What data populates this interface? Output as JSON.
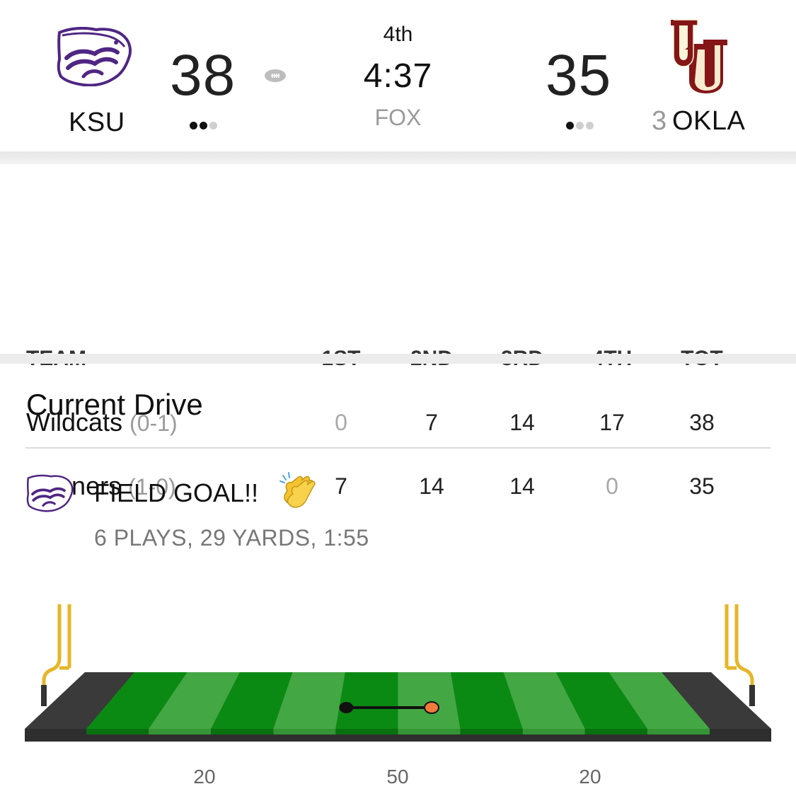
{
  "game": {
    "period": "4th",
    "clock": "4:37",
    "network": "FOX"
  },
  "away": {
    "abbr": "KSU",
    "score": "38",
    "timeouts_used": 2,
    "timeouts_total": 3,
    "color": "#4f2683"
  },
  "home": {
    "rank": "3",
    "abbr": "OKLA",
    "score": "35",
    "timeouts_used": 1,
    "timeouts_total": 3,
    "color": "#841617"
  },
  "possession": "away",
  "linescore": {
    "headers": [
      "TEAM",
      "1ST",
      "2ND",
      "3RD",
      "4TH",
      "TOT"
    ],
    "rows": [
      {
        "name": "Wildcats",
        "record": "(0-1)",
        "q": [
          "0",
          "7",
          "14",
          "17"
        ],
        "total": "38"
      },
      {
        "name": "Sooners",
        "record": "(1-0)",
        "q": [
          "7",
          "14",
          "14",
          "0"
        ],
        "total": "35"
      }
    ]
  },
  "drive": {
    "title": "Current Drive",
    "result": "FIELD GOAL!!",
    "result_icon": "clapping-hands-icon",
    "summary": "6 PLAYS, 29 YARDS, 1:55",
    "start_fraction": 0.4,
    "end_fraction": 0.565
  },
  "field": {
    "yard_labels": [
      "20",
      "50",
      "20"
    ],
    "colors": {
      "dark_green": "#0b8a13",
      "light_green": "#43a843",
      "endzone": "#3a3a3a",
      "goalpost": "#e6b628",
      "ball_end": "#f07a3a"
    }
  }
}
